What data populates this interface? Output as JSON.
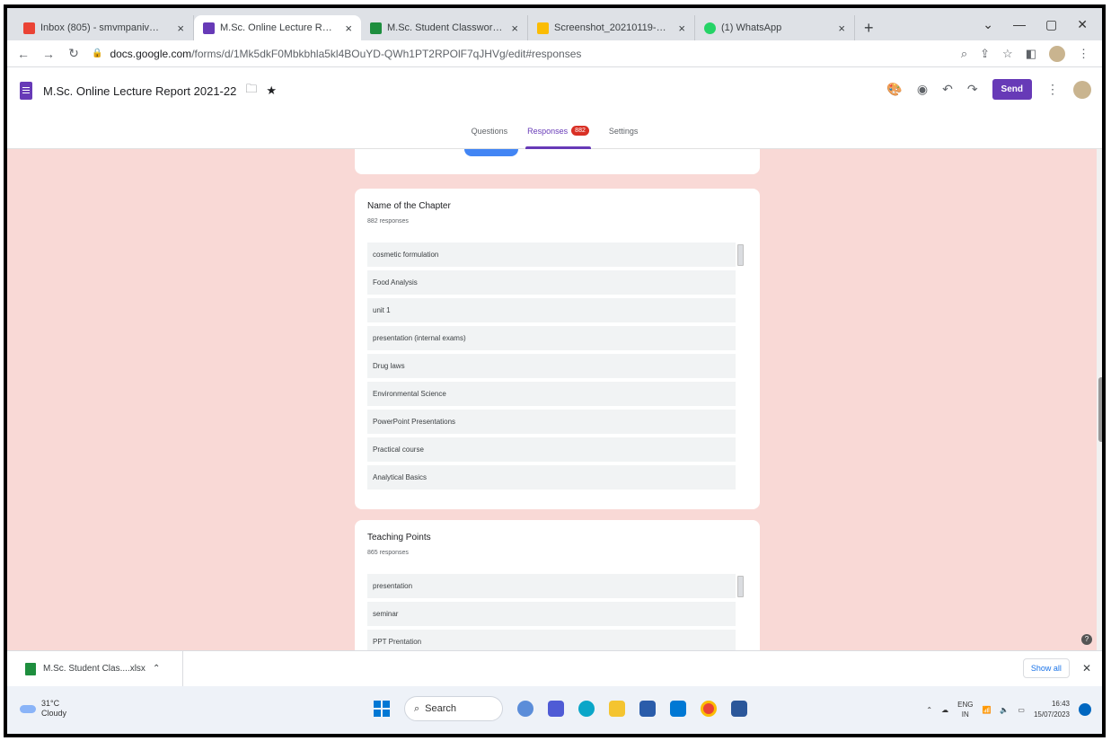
{
  "browser": {
    "tabs": [
      {
        "label": "Inbox (805) - smvmpaniv@gmail",
        "favicon_color": "#ea4335",
        "active": false
      },
      {
        "label": "M.Sc. Online Lecture Report 202",
        "favicon_color": "#673ab7",
        "active": true
      },
      {
        "label": "M.Sc. Student Classwork Report",
        "favicon_color": "#1e8e3e",
        "active": false
      },
      {
        "label": "Screenshot_20210119-113338_2",
        "favicon_color": "#fbbc04",
        "active": false
      },
      {
        "label": "(1) WhatsApp",
        "favicon_color": "#25d366",
        "active": false
      }
    ],
    "close_glyph": "×",
    "new_tab_glyph": "+",
    "url_host": "docs.google.com",
    "url_path": "/forms/d/1Mk5dkF0Mbkbhla5kl4BOuYD-QWh1PT2RPOlF7qJHVg/edit#responses"
  },
  "form": {
    "title": "M.Sc. Online Lecture Report 2021-22",
    "send_label": "Send",
    "tabs": {
      "questions": "Questions",
      "responses": "Responses",
      "responses_badge": "882",
      "settings": "Settings"
    }
  },
  "questions": [
    {
      "title": "Name of the Chapter",
      "count": "882 responses",
      "responses": [
        "cosmetic formulation",
        "Food Analysis",
        "unit 1",
        "presentation (internal exams)",
        "Drug laws",
        "Environmental Science",
        "PowerPoint Presentations",
        "Practical course",
        "Analytical Basics"
      ]
    },
    {
      "title": "Teaching Points",
      "count": "865 responses",
      "responses": [
        "presentation",
        "seminar",
        "PPT Prentation"
      ]
    }
  ],
  "downloads": {
    "file": "M.Sc. Student Clas....xlsx",
    "show_all": "Show all"
  },
  "taskbar": {
    "temperature": "31°C",
    "weather": "Cloudy",
    "search": "Search",
    "lang": "ENG",
    "region": "IN",
    "time": "16:43",
    "date": "15/07/2023"
  }
}
